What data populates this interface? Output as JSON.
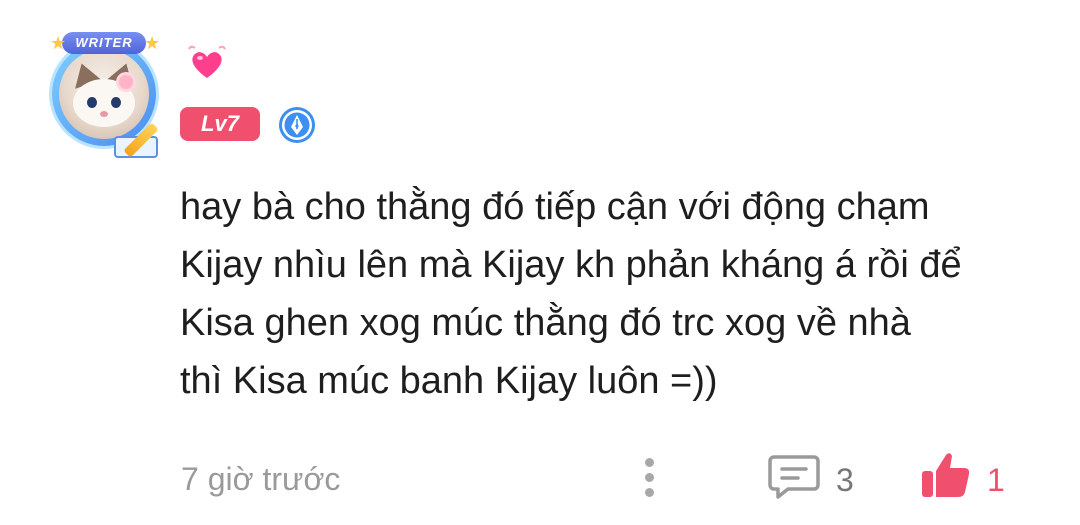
{
  "author": {
    "avatar_frame_label": "WRITER",
    "level": "Lv7",
    "icons": [
      "heart-icon",
      "writer-pen-badge-icon"
    ]
  },
  "comment": {
    "lines": [
      "hay bà cho thằng đó tiếp cận với động chạm",
      "Kijay nhìu lên mà Kijay kh phản kháng á rồi để",
      "Kisa ghen xog múc thằng đó trc xog về nhà",
      "thì Kisa múc banh Kijay luôn =))"
    ]
  },
  "footer": {
    "timestamp": "7 giờ trước",
    "reply_count": "3",
    "like_count": "1",
    "icons": [
      "more-options-icon",
      "reply-icon",
      "thumbs-up-icon"
    ]
  },
  "colors": {
    "accent_pink": "#f0506e",
    "text_primary": "#1e1e1e",
    "text_muted": "#9a9a9a",
    "badge_blue": "#3d8ff0"
  }
}
